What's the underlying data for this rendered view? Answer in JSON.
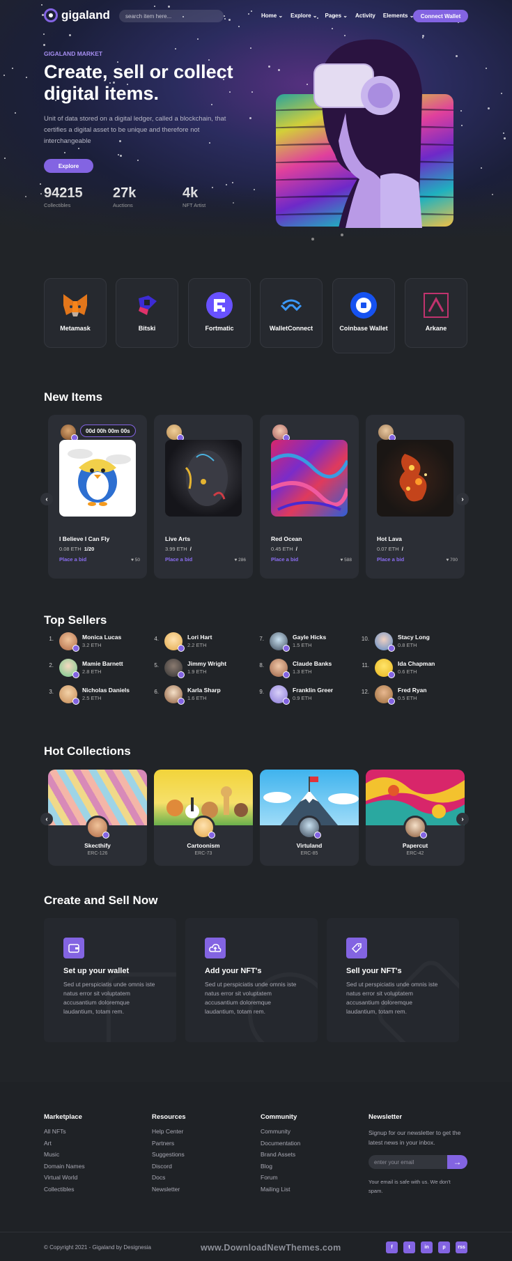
{
  "brand": {
    "name": "gigaland",
    "accent": "#8364e2"
  },
  "search": {
    "placeholder": "search item here..."
  },
  "nav": {
    "items": [
      "Home",
      "Explore",
      "Pages",
      "Activity",
      "Elements"
    ],
    "connect_wallet": "Connect Wallet"
  },
  "hero": {
    "eyebrow": "GIGALAND MARKET",
    "title": "Create, sell or collect digital items.",
    "description": "Unit of data stored on a digital ledger, called a blockchain, that certifies a digital asset to be unique and therefore not interchangeable",
    "cta": "Explore",
    "stats": [
      {
        "value": "94215",
        "label": "Collectibles"
      },
      {
        "value": "27k",
        "label": "Auctions"
      },
      {
        "value": "4k",
        "label": "NFT Artist"
      }
    ]
  },
  "wallets": [
    {
      "name": "Metamask",
      "icon": "metamask-fox-icon"
    },
    {
      "name": "Bitski",
      "icon": "bitski-icon"
    },
    {
      "name": "Fortmatic",
      "icon": "fortmatic-icon"
    },
    {
      "name": "WalletConnect",
      "icon": "walletconnect-icon"
    },
    {
      "name": "Coinbase Wallet",
      "icon": "coinbase-icon"
    },
    {
      "name": "Arkane",
      "icon": "arkane-icon"
    }
  ],
  "new_items": {
    "title": "New Items",
    "timer": "00d 00h 00m 00s",
    "items": [
      {
        "name": "I Believe I Can Fly",
        "price": "0.08 ETH",
        "qty": "1/20",
        "bid": "Place a bid",
        "likes": "50"
      },
      {
        "name": "Live Arts",
        "price": "3.99 ETH",
        "qty": "/",
        "bid": "Place a bid",
        "likes": "286"
      },
      {
        "name": "Red Ocean",
        "price": "0.45 ETH",
        "qty": "/",
        "bid": "Place a bid",
        "likes": "588"
      },
      {
        "name": "Hot Lava",
        "price": "0.07 ETH",
        "qty": "/",
        "bid": "Place a bid",
        "likes": "700"
      }
    ]
  },
  "top_sellers": {
    "title": "Top Sellers",
    "sellers": [
      {
        "rank": "1.",
        "name": "Monica Lucas",
        "eth": "3.2 ETH"
      },
      {
        "rank": "2.",
        "name": "Mamie Barnett",
        "eth": "2.8 ETH"
      },
      {
        "rank": "3.",
        "name": "Nicholas Daniels",
        "eth": "2.5 ETH"
      },
      {
        "rank": "4.",
        "name": "Lori Hart",
        "eth": "2.2 ETH"
      },
      {
        "rank": "5.",
        "name": "Jimmy Wright",
        "eth": "1.9 ETH"
      },
      {
        "rank": "6.",
        "name": "Karla Sharp",
        "eth": "1.6 ETH"
      },
      {
        "rank": "7.",
        "name": "Gayle Hicks",
        "eth": "1.5 ETH"
      },
      {
        "rank": "8.",
        "name": "Claude Banks",
        "eth": "1.3 ETH"
      },
      {
        "rank": "9.",
        "name": "Franklin Greer",
        "eth": "0.9 ETH"
      },
      {
        "rank": "10.",
        "name": "Stacy Long",
        "eth": "0.8 ETH"
      },
      {
        "rank": "11.",
        "name": "Ida Chapman",
        "eth": "0.6 ETH"
      },
      {
        "rank": "12.",
        "name": "Fred Ryan",
        "eth": "0.5 ETH"
      }
    ]
  },
  "hot_collections": {
    "title": "Hot Collections",
    "items": [
      {
        "name": "Skecthify",
        "code": "ERC-126"
      },
      {
        "name": "Cartoonism",
        "code": "ERC-73"
      },
      {
        "name": "Virtuland",
        "code": "ERC-85"
      },
      {
        "name": "Papercut",
        "code": "ERC-42"
      }
    ]
  },
  "create_sell": {
    "title": "Create and Sell Now",
    "steps": [
      {
        "title": "Set up your wallet",
        "desc": "Sed ut perspiciatis unde omnis iste natus error sit voluptatem accusantium doloremque laudantium, totam rem.",
        "icon": "wallet-icon"
      },
      {
        "title": "Add your NFT's",
        "desc": "Sed ut perspiciatis unde omnis iste natus error sit voluptatem accusantium doloremque laudantium, totam rem.",
        "icon": "cloud-upload-icon"
      },
      {
        "title": "Sell your NFT's",
        "desc": "Sed ut perspiciatis unde omnis iste natus error sit voluptatem accusantium doloremque laudantium, totam rem.",
        "icon": "tag-icon"
      }
    ]
  },
  "footer": {
    "marketplace": {
      "title": "Marketplace",
      "links": [
        "All NFTs",
        "Art",
        "Music",
        "Domain Names",
        "Virtual World",
        "Collectibles"
      ]
    },
    "resources": {
      "title": "Resources",
      "links": [
        "Help Center",
        "Partners",
        "Suggestions",
        "Discord",
        "Docs",
        "Newsletter"
      ]
    },
    "community": {
      "title": "Community",
      "links": [
        "Community",
        "Documentation",
        "Brand Assets",
        "Blog",
        "Forum",
        "Mailing List"
      ]
    },
    "newsletter": {
      "title": "Newsletter",
      "text": "Signup for our newsletter to get the latest news in your inbox.",
      "placeholder": "enter your email",
      "note": "Your email is safe with us. We don't spam."
    },
    "copyright": "© Copyright 2021 - Gigaland by Designesia",
    "watermark": "www.DownloadNewThemes.com",
    "socials": [
      "f",
      "t",
      "in",
      "p",
      "rss"
    ]
  }
}
